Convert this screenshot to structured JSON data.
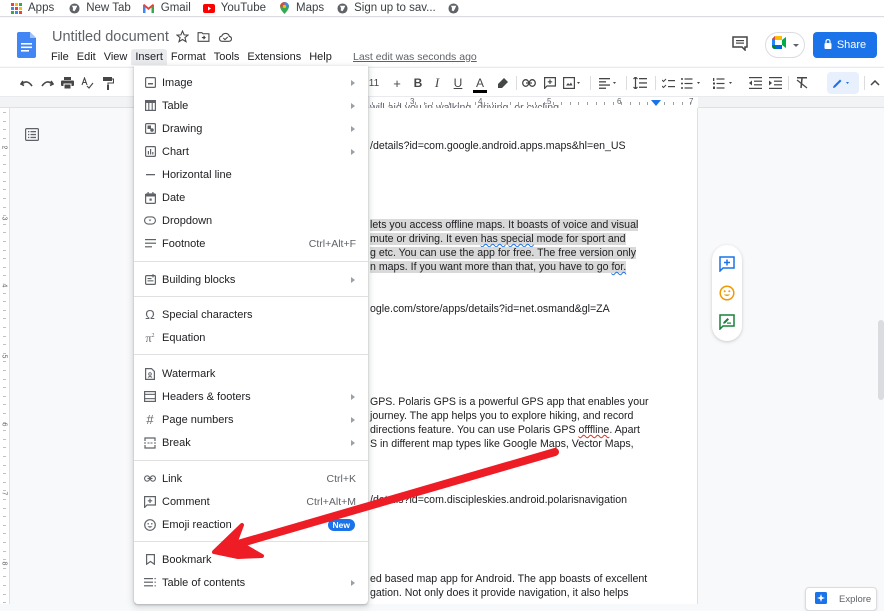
{
  "bookmarks": [
    {
      "label": "Apps",
      "icon": "apps-grid-icon"
    },
    {
      "label": "New Tab",
      "icon": "globe-icon"
    },
    {
      "label": "Gmail",
      "icon": "gmail-icon"
    },
    {
      "label": "YouTube",
      "icon": "youtube-icon"
    },
    {
      "label": "Maps",
      "icon": "maps-pin-icon"
    },
    {
      "label": "Sign up to sav...",
      "icon": "globe-icon"
    },
    {
      "label": "",
      "icon": "globe-icon"
    }
  ],
  "header": {
    "title": "Untitled document",
    "last_edit": "Last edit was seconds ago",
    "share_label": "Share",
    "menus": [
      "File",
      "Edit",
      "View",
      "Insert",
      "Format",
      "Tools",
      "Extensions",
      "Help"
    ],
    "active_menu": "Insert"
  },
  "toolbar": {
    "font_size": "11",
    "plus": "+",
    "bold": "B",
    "italic": "I",
    "underline": "U",
    "text_color": "A"
  },
  "ruler": {
    "numbers": [
      "3",
      "4",
      "5",
      "6",
      "7"
    ],
    "vertical_numbers": [
      "2",
      "3",
      "4",
      "5",
      "6",
      "7",
      "8"
    ]
  },
  "document": {
    "lines": [
      {
        "text": "will aid you in walking, driving, or cycling.",
        "highlight": false
      },
      {
        "text": "/details?id=com.google.android.apps.maps&hl=en_US",
        "highlight": false
      },
      {
        "text": " lets you access offline maps.   It boasts of voice and visual",
        "highlight": true
      },
      {
        "pre": " mute or driving. It even ",
        "squiggle": "has special",
        "post": " mode for sport and",
        "highlight": true
      },
      {
        "text": "g etc. You can use the app for free. The free version only",
        "highlight": true
      },
      {
        "pre": "n maps. If you want more than that, you have to go ",
        "squiggle": "for.",
        "post": "",
        "highlight": true
      },
      {
        "text": "ogle.com/store/apps/details?id=net.osmand&gl=ZA",
        "highlight": false
      },
      {
        "text": " GPS. Polaris GPS is a powerful GPS app that enables your",
        "highlight": false
      },
      {
        "text": " journey. The app helps you to explore hiking, and record",
        "highlight": false
      },
      {
        "pre": " directions feature. You can use Polaris GPS ",
        "red": "offfline",
        "post": ". Apart",
        "highlight": false
      },
      {
        "text": "S in different map types like Google Maps, Vector Maps,",
        "highlight": false
      },
      {
        "text": "/details?id=com.discipleskies.android.polarisnavigation",
        "highlight": false
      },
      {
        "text": "ed based map app for Android. The app boasts of excellent",
        "highlight": false
      },
      {
        "text": "gation. Not only does it provide navigation, it also helps",
        "highlight": false
      }
    ]
  },
  "insert_menu": {
    "items": [
      {
        "label": "Image",
        "icon": "image-icon",
        "submenu": true
      },
      {
        "label": "Table",
        "icon": "table-icon",
        "submenu": true
      },
      {
        "label": "Drawing",
        "icon": "drawing-icon",
        "submenu": true
      },
      {
        "label": "Chart",
        "icon": "chart-icon",
        "submenu": true
      },
      {
        "label": "Horizontal line",
        "icon": "horizontal-line-icon"
      },
      {
        "label": "Date",
        "icon": "calendar-icon"
      },
      {
        "label": "Dropdown",
        "icon": "dropdown-icon"
      },
      {
        "label": "Footnote",
        "icon": "footnote-icon",
        "shortcut": "Ctrl+Alt+F"
      },
      {
        "label": "Building blocks",
        "icon": "building-blocks-icon",
        "submenu": true
      },
      {
        "label": "Special characters",
        "icon": "omega-icon"
      },
      {
        "label": "Equation",
        "icon": "pi-icon"
      },
      {
        "label": "Watermark",
        "icon": "watermark-icon"
      },
      {
        "label": "Headers & footers",
        "icon": "headers-footers-icon",
        "submenu": true
      },
      {
        "label": "Page numbers",
        "icon": "hash-icon",
        "submenu": true
      },
      {
        "label": "Break",
        "icon": "break-icon",
        "submenu": true
      },
      {
        "label": "Link",
        "icon": "link-icon",
        "shortcut": "Ctrl+K"
      },
      {
        "label": "Comment",
        "icon": "comment-add-icon",
        "shortcut": "Ctrl+Alt+M"
      },
      {
        "label": "Emoji reaction",
        "icon": "emoji-icon",
        "badge": "New"
      },
      {
        "label": "Bookmark",
        "icon": "bookmark-icon"
      },
      {
        "label": "Table of contents",
        "icon": "toc-icon",
        "submenu": true
      }
    ]
  },
  "side_actions": [
    "add-comment",
    "add-emoji-reaction",
    "suggest-edits"
  ],
  "explore_label": "Explore",
  "colors": {
    "accent": "#1a73e8",
    "annotation_arrow": "#ee1c25",
    "text_highlight": "#d9d9d9"
  }
}
